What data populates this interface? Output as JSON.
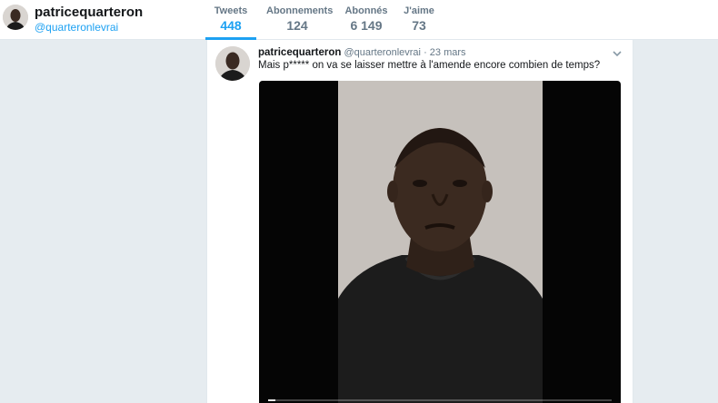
{
  "profile": {
    "name": "patricequarteron",
    "handle": "@quarteronlevrai"
  },
  "stats": [
    {
      "label": "Tweets",
      "value": "448",
      "active": true
    },
    {
      "label": "Abonnements",
      "value": "124",
      "active": false
    },
    {
      "label": "Abonnés",
      "value": "6 149",
      "active": false
    },
    {
      "label": "J'aime",
      "value": "73",
      "active": false
    }
  ],
  "tweet": {
    "name": "patricequarteron",
    "handle": "@quarteronlevrai",
    "separator": "·",
    "date": "23 mars",
    "text": "Mais p***** on va se laisser mettre à l'amende encore combien de temps?",
    "video": {
      "progress": 0.02
    }
  },
  "colors": {
    "accent": "#1da1f2",
    "background": "#e6ecf0",
    "muted": "#657786",
    "text": "#14171a"
  },
  "icons": {
    "caret": "chevron-down-icon"
  }
}
